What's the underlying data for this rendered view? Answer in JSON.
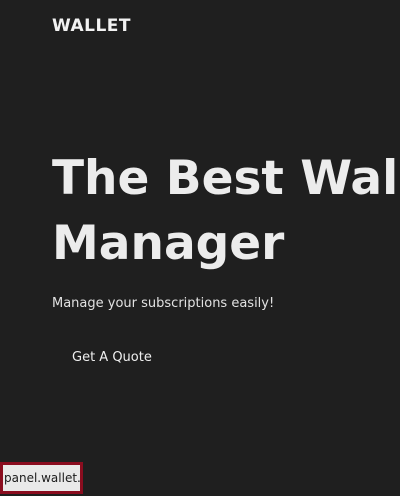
{
  "header": {
    "brand": "WALLET"
  },
  "hero": {
    "title_line1": "The Best Wall",
    "title_line2": "Manager",
    "subtitle": "Manage your subscriptions easily!",
    "cta_label": "Get A Quote"
  },
  "status_bar": {
    "url": "panel.wallet.dl"
  },
  "colors": {
    "background": "#1f1f1f",
    "text": "#ececec",
    "status_border": "#8a0d1f",
    "status_background": "#e9e9e9"
  }
}
